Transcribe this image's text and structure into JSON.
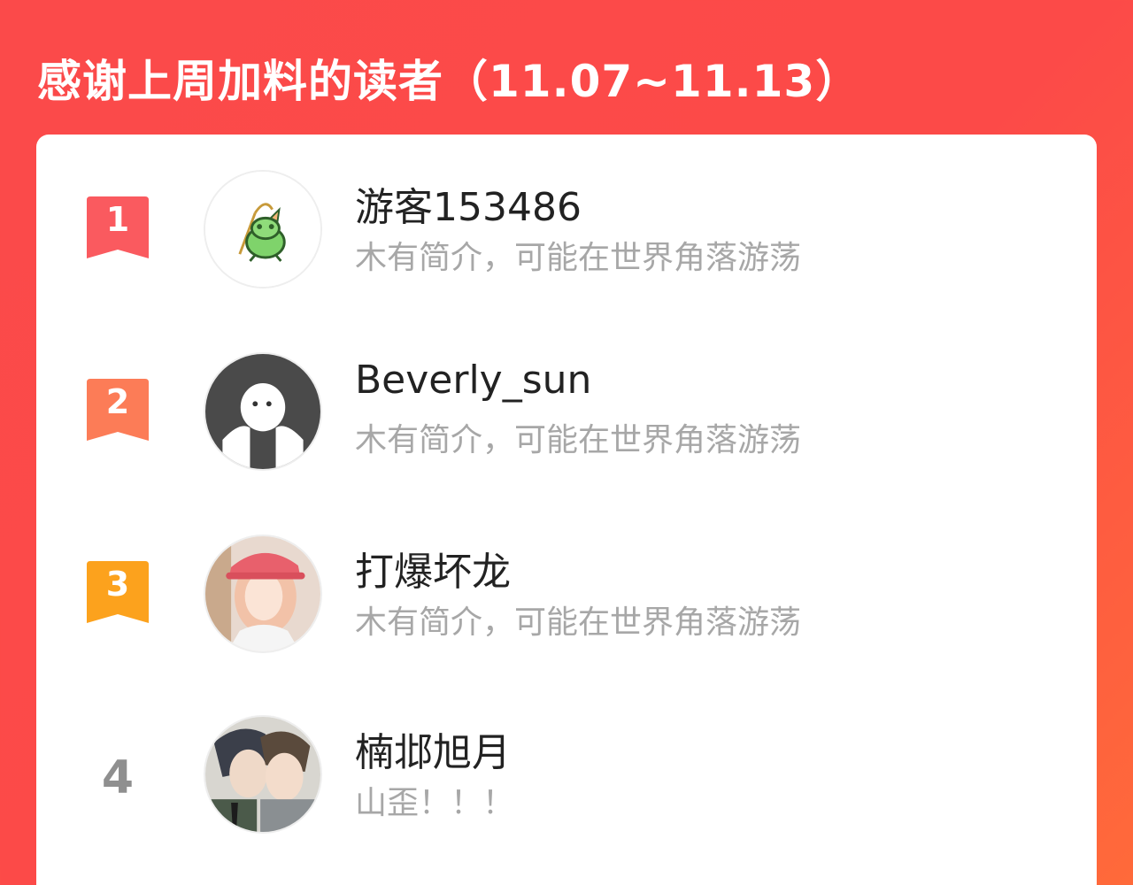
{
  "header": {
    "title": "感谢上周加料的读者（11.07~11.13）"
  },
  "colors": {
    "background": "#fb4a4a",
    "rank1": "#fa5a5f",
    "rank2": "#fc7c57",
    "rank3": "#fca21d",
    "card": "#ffffff"
  },
  "readers": [
    {
      "rank": "1",
      "name": "游客153486",
      "bio": "木有简介，可能在世界角落游荡",
      "avatar": "frog-avatar-icon"
    },
    {
      "rank": "2",
      "name": "Beverly_sun",
      "bio": "木有简介，可能在世界角落游荡",
      "avatar": "default-ghost-avatar-icon"
    },
    {
      "rank": "3",
      "name": "打爆坏龙",
      "bio": "木有简介，可能在世界角落游荡",
      "avatar": "photo-avatar"
    },
    {
      "rank": "4",
      "name": "楠邶旭月",
      "bio": "山歪！！！",
      "avatar": "comic-avatar"
    }
  ]
}
